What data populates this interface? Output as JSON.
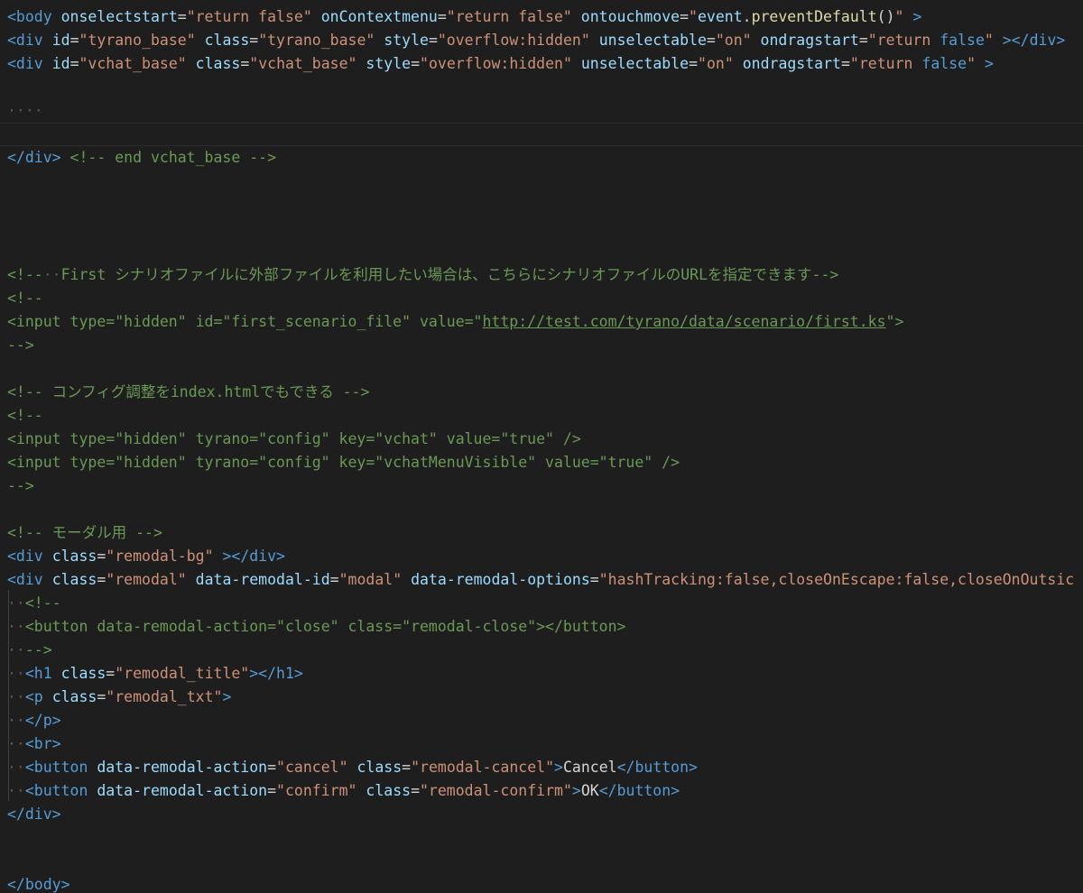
{
  "editor": {
    "background": "#1e1e1e",
    "colors": {
      "tag": "#569cd6",
      "attribute": "#9cdcfe",
      "string": "#ce9178",
      "comment": "#6a9955",
      "function": "#dcdcaa",
      "text": "#d4d4d4",
      "whitespace": "#5a5a5a"
    },
    "lines": [
      {
        "tokens": [
          [
            "tag",
            "<body"
          ],
          [
            "text",
            " "
          ],
          [
            "attr",
            "onselectstart"
          ],
          [
            "text",
            "="
          ],
          [
            "str",
            "\"return false\""
          ],
          [
            "text",
            " "
          ],
          [
            "attr",
            "onContextmenu"
          ],
          [
            "text",
            "="
          ],
          [
            "str",
            "\"return false\""
          ],
          [
            "text",
            " "
          ],
          [
            "attr",
            "ontouchmove"
          ],
          [
            "text",
            "="
          ],
          [
            "str",
            "\""
          ],
          [
            "attr",
            "event"
          ],
          [
            "text",
            "."
          ],
          [
            "fn",
            "preventDefault"
          ],
          [
            "text",
            "()"
          ],
          [
            "str",
            "\""
          ],
          [
            "text",
            " "
          ],
          [
            "tag",
            ">"
          ]
        ]
      },
      {
        "tokens": [
          [
            "tag",
            "<div"
          ],
          [
            "text",
            " "
          ],
          [
            "attr",
            "id"
          ],
          [
            "text",
            "="
          ],
          [
            "str",
            "\"tyrano_base\""
          ],
          [
            "text",
            " "
          ],
          [
            "attr",
            "class"
          ],
          [
            "text",
            "="
          ],
          [
            "str",
            "\"tyrano_base\""
          ],
          [
            "text",
            " "
          ],
          [
            "attr",
            "style"
          ],
          [
            "text",
            "="
          ],
          [
            "str",
            "\"overflow:hidden\""
          ],
          [
            "text",
            " "
          ],
          [
            "attr",
            "unselectable"
          ],
          [
            "text",
            "="
          ],
          [
            "str",
            "\"on\""
          ],
          [
            "text",
            " "
          ],
          [
            "attr",
            "ondragstart"
          ],
          [
            "text",
            "="
          ],
          [
            "str",
            "\"return "
          ],
          [
            "tag",
            "false"
          ],
          [
            "str",
            "\""
          ],
          [
            "text",
            " "
          ],
          [
            "tag",
            "></div>"
          ]
        ]
      },
      {
        "tokens": [
          [
            "tag",
            "<div"
          ],
          [
            "text",
            " "
          ],
          [
            "attr",
            "id"
          ],
          [
            "text",
            "="
          ],
          [
            "str",
            "\"vchat_base\""
          ],
          [
            "text",
            " "
          ],
          [
            "attr",
            "class"
          ],
          [
            "text",
            "="
          ],
          [
            "str",
            "\"vchat_base\""
          ],
          [
            "text",
            " "
          ],
          [
            "attr",
            "style"
          ],
          [
            "text",
            "="
          ],
          [
            "str",
            "\"overflow:hidden\""
          ],
          [
            "text",
            " "
          ],
          [
            "attr",
            "unselectable"
          ],
          [
            "text",
            "="
          ],
          [
            "str",
            "\"on\""
          ],
          [
            "text",
            " "
          ],
          [
            "attr",
            "ondragstart"
          ],
          [
            "text",
            "="
          ],
          [
            "str",
            "\"return "
          ],
          [
            "tag",
            "false"
          ],
          [
            "str",
            "\""
          ],
          [
            "text",
            " "
          ],
          [
            "tag",
            ">"
          ]
        ]
      },
      {
        "tokens": []
      },
      {
        "tokens": [
          [
            "ws",
            "····"
          ]
        ]
      },
      {
        "tokens": [],
        "current": true
      },
      {
        "tokens": [
          [
            "tag",
            "</div>"
          ],
          [
            "text",
            " "
          ],
          [
            "comment",
            "<!-- end vchat_base -->"
          ]
        ]
      },
      {
        "tokens": []
      },
      {
        "tokens": []
      },
      {
        "tokens": []
      },
      {
        "tokens": []
      },
      {
        "tokens": [
          [
            "comment",
            "<!--"
          ],
          [
            "ws",
            "··"
          ],
          [
            "comment",
            "First シナリオファイルに外部ファイルを利用したい場合は、こちらにシナリオファイルのURLを指定できます-->"
          ]
        ]
      },
      {
        "tokens": [
          [
            "comment",
            "<!--"
          ]
        ]
      },
      {
        "tokens": [
          [
            "comment",
            "<input type=\"hidden\" id=\"first_scenario_file\" value=\""
          ],
          [
            "comment-link",
            "http://test.com/tyrano/data/scenario/first.ks"
          ],
          [
            "comment",
            "\">"
          ]
        ]
      },
      {
        "tokens": [
          [
            "comment",
            "-->"
          ]
        ]
      },
      {
        "tokens": []
      },
      {
        "tokens": [
          [
            "comment",
            "<!-- コンフィグ調整をindex.htmlでもできる -->"
          ]
        ]
      },
      {
        "tokens": [
          [
            "comment",
            "<!--"
          ]
        ]
      },
      {
        "tokens": [
          [
            "comment",
            "<input type=\"hidden\" tyrano=\"config\" key=\"vchat\" value=\"true\" />"
          ]
        ]
      },
      {
        "tokens": [
          [
            "comment",
            "<input type=\"hidden\" tyrano=\"config\" key=\"vchatMenuVisible\" value=\"true\" />"
          ]
        ]
      },
      {
        "tokens": [
          [
            "comment",
            "-->"
          ]
        ]
      },
      {
        "tokens": []
      },
      {
        "tokens": [
          [
            "comment",
            "<!-- モーダル用 -->"
          ]
        ]
      },
      {
        "tokens": [
          [
            "tag",
            "<div"
          ],
          [
            "text",
            " "
          ],
          [
            "attr",
            "class"
          ],
          [
            "text",
            "="
          ],
          [
            "str",
            "\"remodal-bg\""
          ],
          [
            "text",
            " "
          ],
          [
            "tag",
            "></div>"
          ]
        ]
      },
      {
        "tokens": [
          [
            "tag",
            "<div"
          ],
          [
            "text",
            " "
          ],
          [
            "attr",
            "class"
          ],
          [
            "text",
            "="
          ],
          [
            "str",
            "\"remodal\""
          ],
          [
            "text",
            " "
          ],
          [
            "attr",
            "data-remodal-id"
          ],
          [
            "text",
            "="
          ],
          [
            "str",
            "\"modal\""
          ],
          [
            "text",
            " "
          ],
          [
            "attr",
            "data-remodal-options"
          ],
          [
            "text",
            "="
          ],
          [
            "str",
            "\"hashTracking:false,closeOnEscape:false,closeOnOutsic"
          ]
        ]
      },
      {
        "tokens": [
          [
            "ws",
            "··"
          ],
          [
            "comment",
            "<!--"
          ]
        ]
      },
      {
        "tokens": [
          [
            "ws",
            "··"
          ],
          [
            "comment",
            "<button data-remodal-action=\"close\" class=\"remodal-close\"></button>"
          ]
        ]
      },
      {
        "tokens": [
          [
            "ws",
            "··"
          ],
          [
            "comment",
            "-->"
          ]
        ]
      },
      {
        "tokens": [
          [
            "ws",
            "··"
          ],
          [
            "tag",
            "<h1"
          ],
          [
            "text",
            " "
          ],
          [
            "attr",
            "class"
          ],
          [
            "text",
            "="
          ],
          [
            "str",
            "\"remodal_title\""
          ],
          [
            "tag",
            "></h1>"
          ]
        ]
      },
      {
        "tokens": [
          [
            "ws",
            "··"
          ],
          [
            "tag",
            "<p"
          ],
          [
            "text",
            " "
          ],
          [
            "attr",
            "class"
          ],
          [
            "text",
            "="
          ],
          [
            "str",
            "\"remodal_txt\""
          ],
          [
            "tag",
            ">"
          ]
        ]
      },
      {
        "tokens": [
          [
            "ws",
            "··"
          ],
          [
            "tag",
            "</p>"
          ]
        ]
      },
      {
        "tokens": [
          [
            "ws",
            "··"
          ],
          [
            "tag",
            "<br>"
          ]
        ]
      },
      {
        "tokens": [
          [
            "ws",
            "··"
          ],
          [
            "tag",
            "<button"
          ],
          [
            "text",
            " "
          ],
          [
            "attr",
            "data-remodal-action"
          ],
          [
            "text",
            "="
          ],
          [
            "str",
            "\"cancel\""
          ],
          [
            "text",
            " "
          ],
          [
            "attr",
            "class"
          ],
          [
            "text",
            "="
          ],
          [
            "str",
            "\"remodal-cancel\""
          ],
          [
            "tag",
            ">"
          ],
          [
            "text",
            "Cancel"
          ],
          [
            "tag",
            "</button>"
          ]
        ]
      },
      {
        "tokens": [
          [
            "ws",
            "··"
          ],
          [
            "tag",
            "<button"
          ],
          [
            "text",
            " "
          ],
          [
            "attr",
            "data-remodal-action"
          ],
          [
            "text",
            "="
          ],
          [
            "str",
            "\"confirm\""
          ],
          [
            "text",
            " "
          ],
          [
            "attr",
            "class"
          ],
          [
            "text",
            "="
          ],
          [
            "str",
            "\"remodal-confirm\""
          ],
          [
            "tag",
            ">"
          ],
          [
            "text",
            "OK"
          ],
          [
            "tag",
            "</button>"
          ]
        ]
      },
      {
        "tokens": [
          [
            "tag",
            "</div>"
          ]
        ]
      },
      {
        "tokens": []
      },
      {
        "tokens": []
      },
      {
        "tokens": [
          [
            "tag",
            "</body>"
          ]
        ]
      }
    ]
  }
}
